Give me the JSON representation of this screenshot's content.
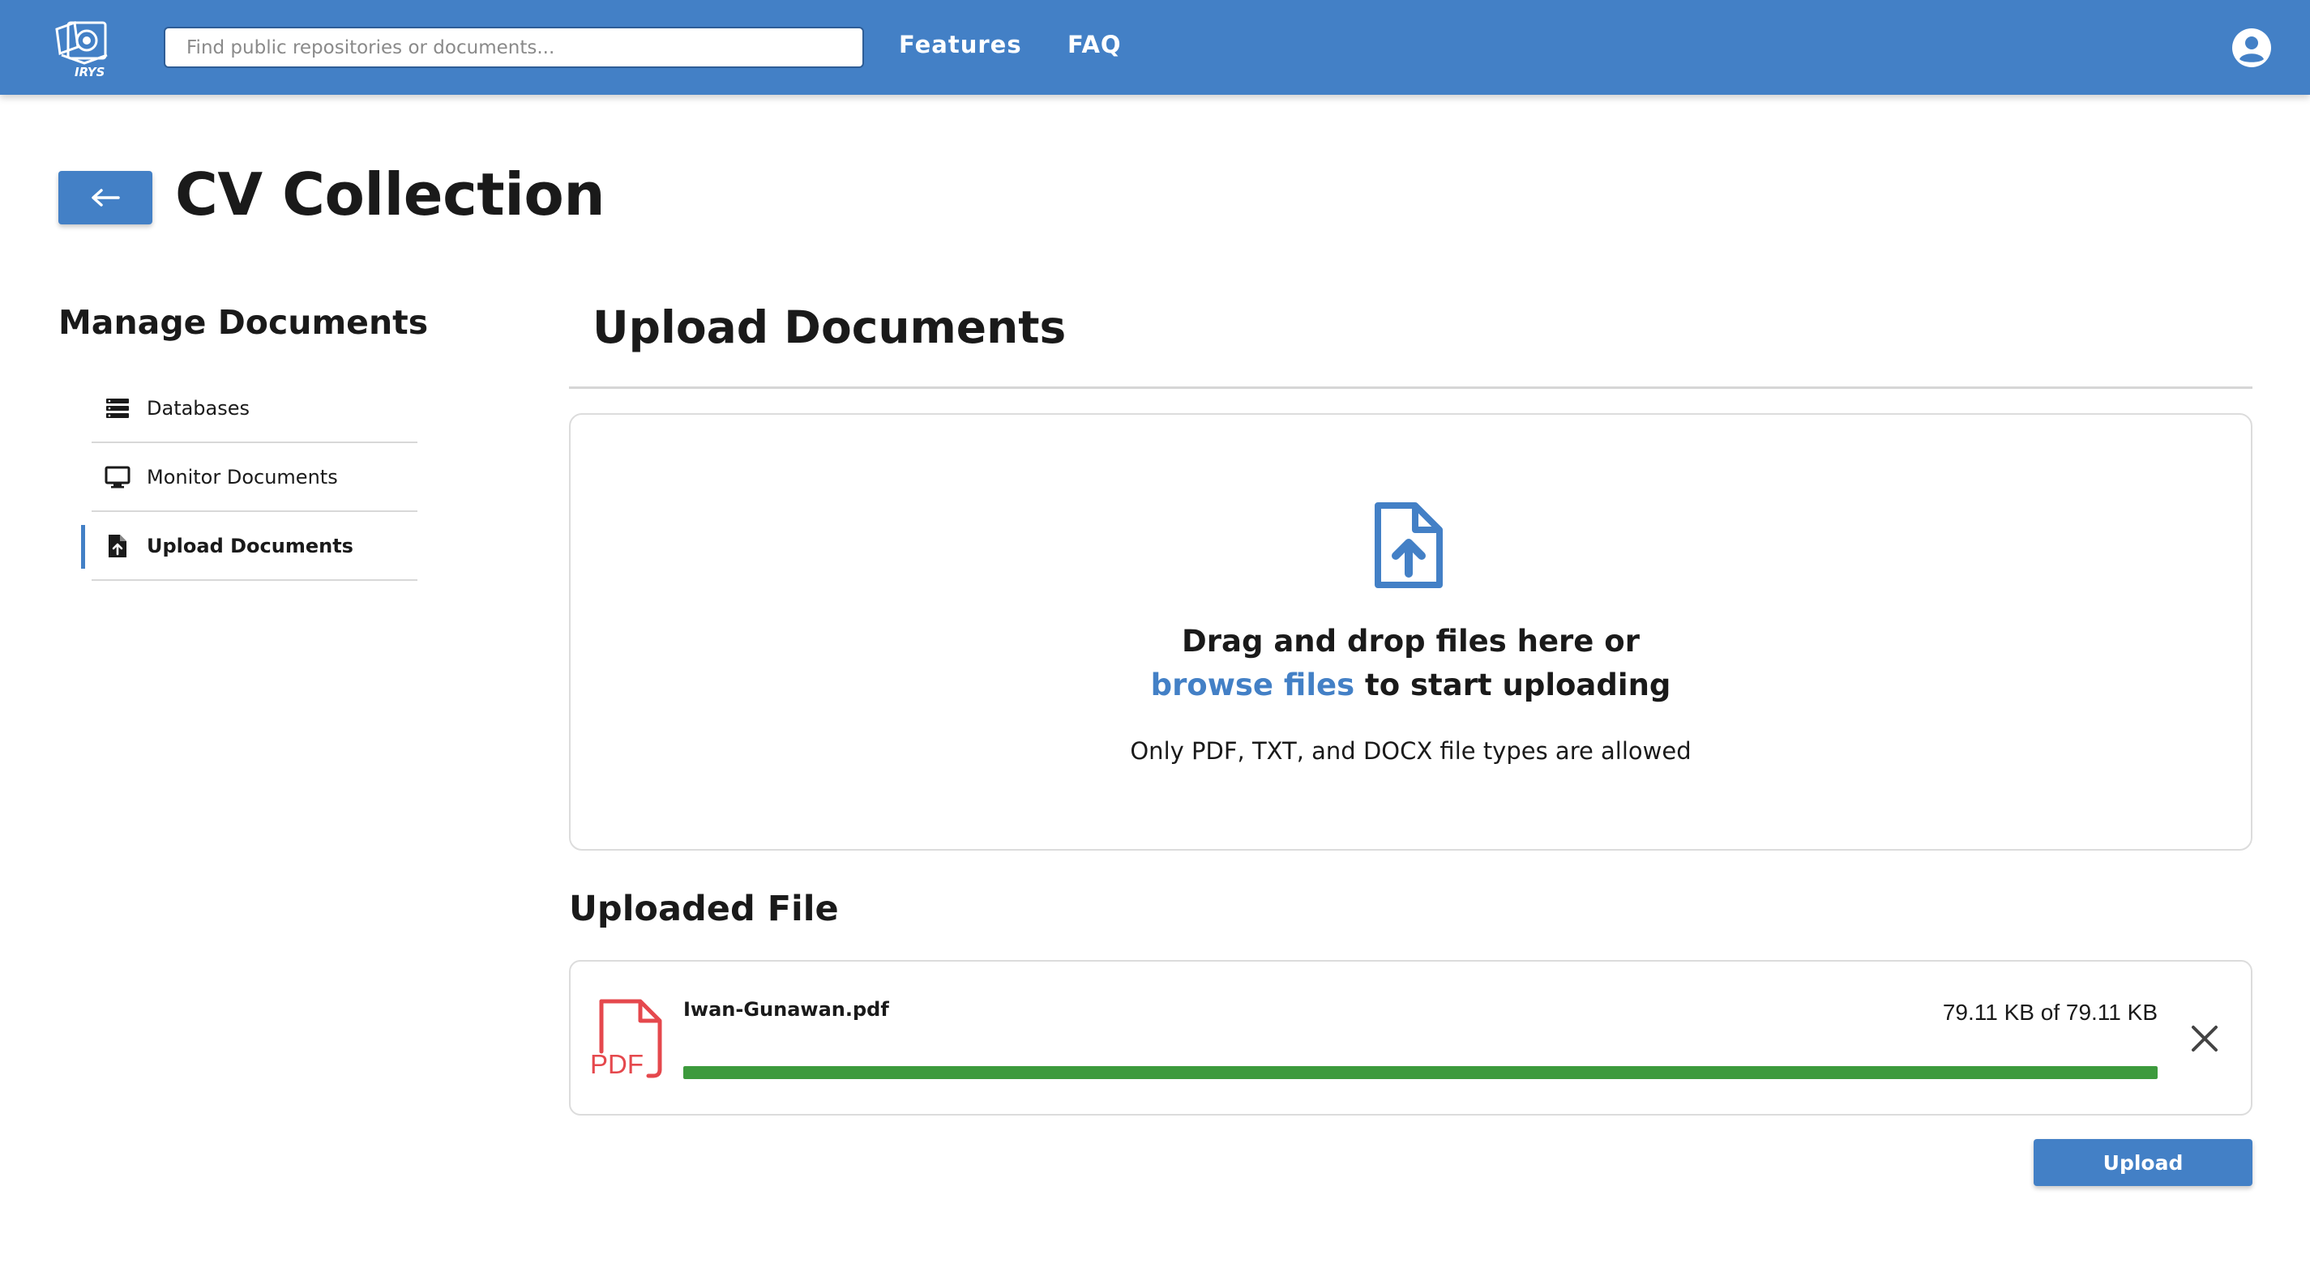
{
  "header": {
    "logo_text": "IRYS",
    "search_placeholder": "Find public repositories or documents...",
    "nav": [
      {
        "label": "Features"
      },
      {
        "label": "FAQ"
      }
    ],
    "account_icon": "account-circle-icon",
    "bar_color": "#4380c6"
  },
  "page": {
    "title": "CV Collection",
    "back_icon": "arrow-left-icon"
  },
  "sidebar": {
    "title": "Manage Documents",
    "items": [
      {
        "label": "Databases",
        "icon": "database-icon",
        "active": false
      },
      {
        "label": "Monitor Documents",
        "icon": "monitor-icon",
        "active": false
      },
      {
        "label": "Upload Documents",
        "icon": "file-upload-icon",
        "active": true
      }
    ]
  },
  "main": {
    "title": "Upload Documents",
    "dropzone": {
      "line1": "Drag and drop files here or",
      "browse_link": "browse files",
      "line2_rest": " to start uploading",
      "note": "Only PDF, TXT, and DOCX file types are allowed",
      "icon": "file-upload-icon"
    },
    "uploaded": {
      "title": "Uploaded File",
      "files": [
        {
          "name": "Iwan-Gunawan.pdf",
          "icon_label": "PDF",
          "size_text": "79.11 KB of 79.11 KB",
          "progress": 1.0
        }
      ]
    },
    "upload_button": "Upload"
  },
  "colors": {
    "accent": "#4380c6",
    "progress": "#3c9a3c",
    "pdf": "#e5484d"
  }
}
